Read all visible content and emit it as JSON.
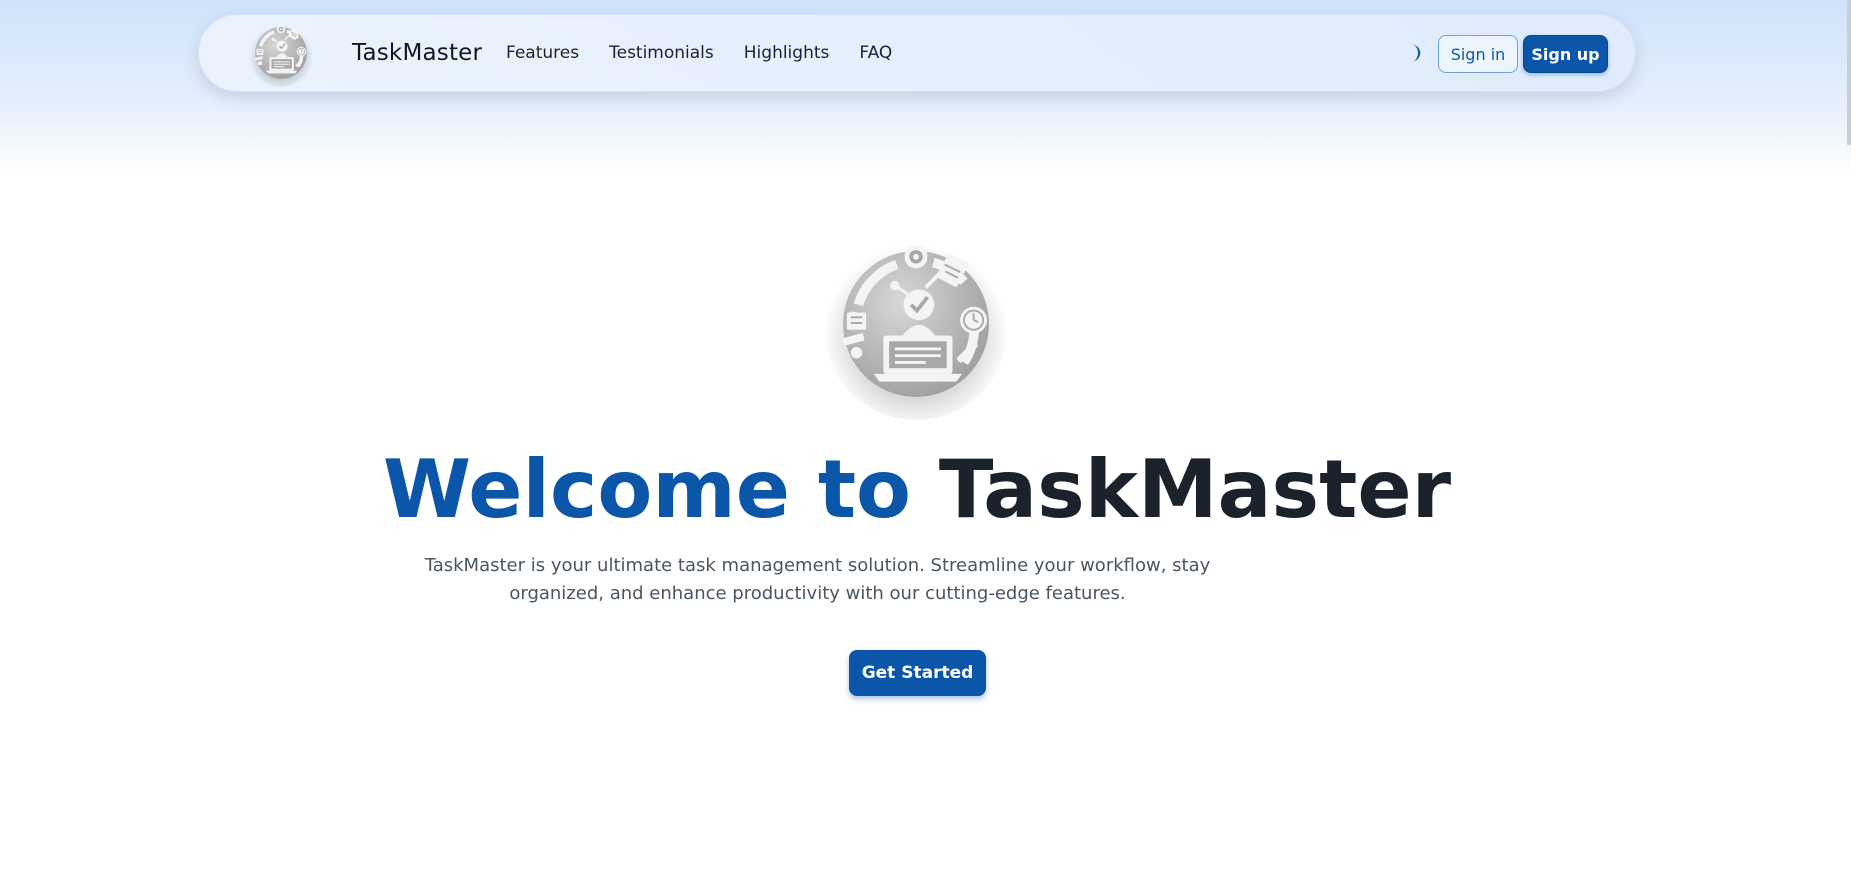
{
  "header": {
    "brand": "TaskMaster",
    "nav": [
      {
        "label": "Features"
      },
      {
        "label": "Testimonials"
      },
      {
        "label": "Highlights"
      },
      {
        "label": "FAQ"
      }
    ],
    "theme_toggle_icon": "moon-icon",
    "signin_label": "Sign in",
    "signup_label": "Sign up"
  },
  "hero": {
    "logo_icon": "taskmaster-logo-icon",
    "title_accent": "Welcome to",
    "title_main": "TaskMaster",
    "description": "TaskMaster is your ultimate task management solution. Streamline your workflow, stay organized, and enhance productivity with our cutting-edge features.",
    "cta_label": "Get Started"
  },
  "colors": {
    "primary": "#0b56a8",
    "text_dark": "#1b222b",
    "text_muted": "#4a5562",
    "header_gradient_top": "#cfe3fb"
  }
}
